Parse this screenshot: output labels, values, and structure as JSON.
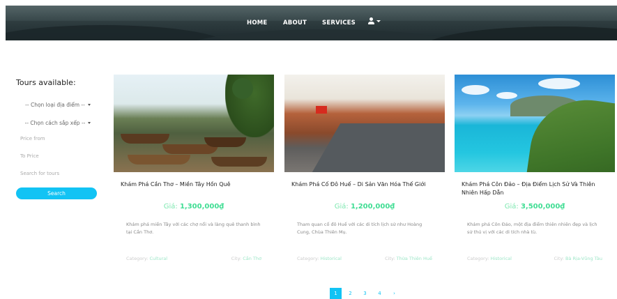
{
  "nav": {
    "home": "HOME",
    "about": "ABOUT",
    "services": "SERVICES"
  },
  "sidebar": {
    "title": "Tours available:",
    "location_select": "-- Chọn loại địa điểm --",
    "sort_select": "-- Chọn cách sắp xếp --",
    "price_from_placeholder": "Price from",
    "price_to_placeholder": "To Price",
    "search_placeholder": "Search for tours",
    "search_button": "Search"
  },
  "tours": [
    {
      "title": "Khám Phá Cần Thơ – Miền Tây Hồn Quê",
      "price_label": "Giá:",
      "price": "1,300,000₫",
      "description": "Khám phá miền Tây với các chợ nổi và làng quê thanh bình tại Cần Thơ.",
      "category_label": "Category:",
      "category": "Cultural",
      "city_label": "City:",
      "city": "Cần Thơ"
    },
    {
      "title": "Khám Phá Cố Đô Huế – Di Sản Văn Hóa Thế Giới",
      "price_label": "Giá:",
      "price": "1,200,000₫",
      "description": "Tham quan cố đô Huế với các di tích lịch sử như Hoàng Cung, Chùa Thiên Mụ.",
      "category_label": "Category:",
      "category": "Historical",
      "city_label": "City:",
      "city": "Thừa Thiên Huế"
    },
    {
      "title": "Khám Phá Côn Đảo – Địa Điểm Lịch Sử Và Thiên Nhiên Hấp Dẫn",
      "price_label": "Giá:",
      "price": "3,500,000₫",
      "description": "Khám phá Côn Đảo, một địa điểm thiên nhiên đẹp và lịch sử thú vị với các di tích nhà tù.",
      "category_label": "Category:",
      "category": "Historical",
      "city_label": "City:",
      "city": "Bà Rịa-Vũng Tàu"
    }
  ],
  "pagination": [
    "1",
    "2",
    "3",
    "4",
    "›"
  ],
  "colors": {
    "accent": "#12c3f4",
    "price": "#3fdd93"
  }
}
